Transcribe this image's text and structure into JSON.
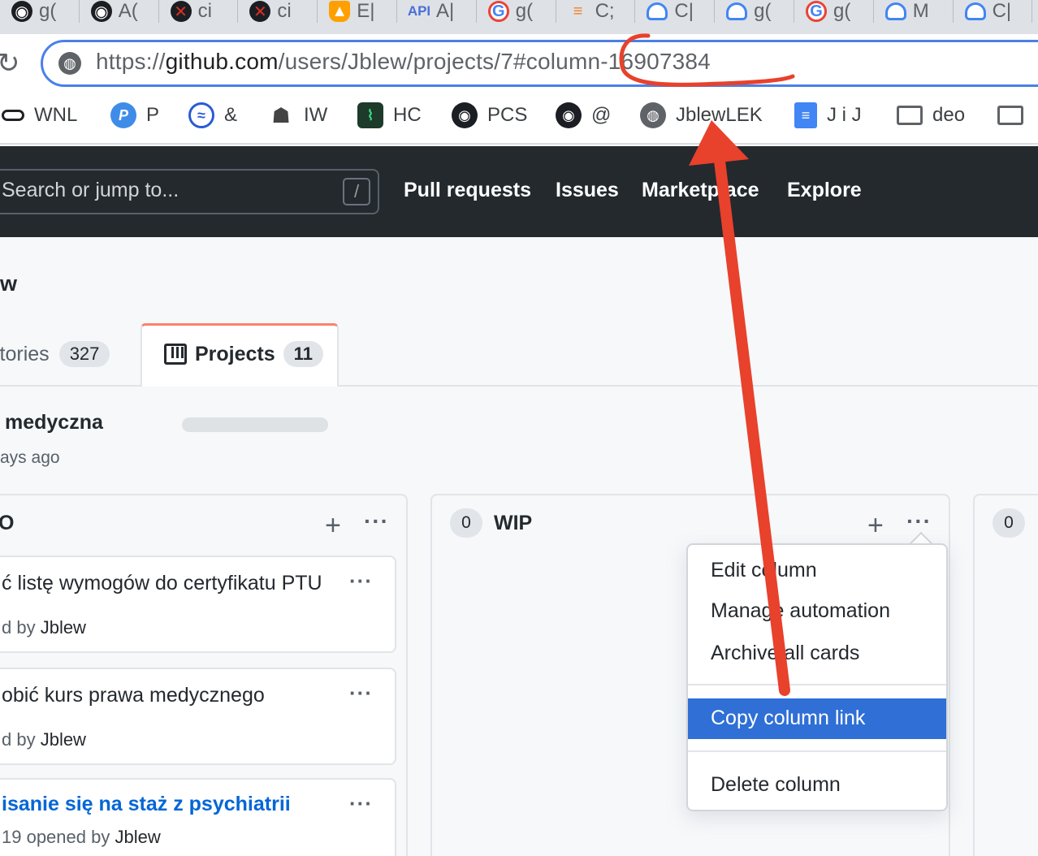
{
  "browser": {
    "tabs": [
      {
        "icon": "github-icon",
        "label": "g("
      },
      {
        "icon": "github-icon",
        "label": "A("
      },
      {
        "icon": "github-error-icon",
        "label": "ci"
      },
      {
        "icon": "github-error-icon",
        "label": "ci"
      },
      {
        "icon": "firebase-icon",
        "label": "E|"
      },
      {
        "icon": "api-icon",
        "label": "A|"
      },
      {
        "icon": "google-icon",
        "label": "g("
      },
      {
        "icon": "stackoverflow-icon",
        "label": "C;"
      },
      {
        "icon": "google-cloud-icon",
        "label": "C|"
      },
      {
        "icon": "google-cloud-icon",
        "label": "g("
      },
      {
        "icon": "google-icon",
        "label": "g("
      },
      {
        "icon": "google-cloud-icon",
        "label": "M"
      },
      {
        "icon": "google-cloud-icon",
        "label": "C|"
      }
    ],
    "url": {
      "scheme": "https://",
      "host": "github.com",
      "path": "/users/Jblew/projects/7#column-16907384"
    },
    "bookmarks": [
      {
        "icon": "toggle-icon",
        "label": "WNL"
      },
      {
        "icon": "p-icon",
        "label": "P"
      },
      {
        "icon": "wave-icon",
        "label": "&"
      },
      {
        "icon": "spy-icon",
        "label": "IW"
      },
      {
        "icon": "pulse-icon",
        "label": "HC"
      },
      {
        "icon": "github-icon",
        "label": "PCS"
      },
      {
        "icon": "github-icon",
        "label": "@"
      },
      {
        "icon": "globe-icon",
        "label": "JblewLEK"
      },
      {
        "icon": "docs-icon",
        "label": "J i J"
      },
      {
        "icon": "folder-icon",
        "label": "deo"
      },
      {
        "icon": "folder-icon",
        "label": ""
      }
    ]
  },
  "github": {
    "search_placeholder": "Search or jump to...",
    "search_key": "/",
    "nav": [
      "Pull requests",
      "Issues",
      "Marketplace",
      "Explore"
    ]
  },
  "profile": {
    "owner_fragment": "w",
    "tabs": [
      {
        "label": "itories",
        "count": "327"
      },
      {
        "label": "Projects",
        "count": "11"
      }
    ]
  },
  "project": {
    "title_fragment": "medyczna",
    "updated_fragment": "ays ago"
  },
  "columns": [
    {
      "name_fragment": "O",
      "cards": [
        {
          "title": "ć listę wymogów do certyfikatu PTU",
          "meta_prefix": "d by ",
          "author": "Jblew"
        },
        {
          "title": "obić kurs prawa medycznego",
          "meta_prefix": "d by ",
          "author": "Jblew"
        },
        {
          "title": "isanie się na staż z psychiatrii",
          "meta_prefix": "19 opened by ",
          "author": "Jblew"
        }
      ]
    },
    {
      "count": "0",
      "name": "WIP"
    },
    {
      "count": "0"
    }
  ],
  "column_menu": {
    "items": [
      "Edit column",
      "Manage automation",
      "Archive all cards"
    ],
    "highlighted": "Copy column link",
    "danger": "Delete column"
  },
  "colors": {
    "annotation": "#e8412c",
    "menu_highlight": "#2f6fd6",
    "omnibox_border": "#4a80e8"
  }
}
